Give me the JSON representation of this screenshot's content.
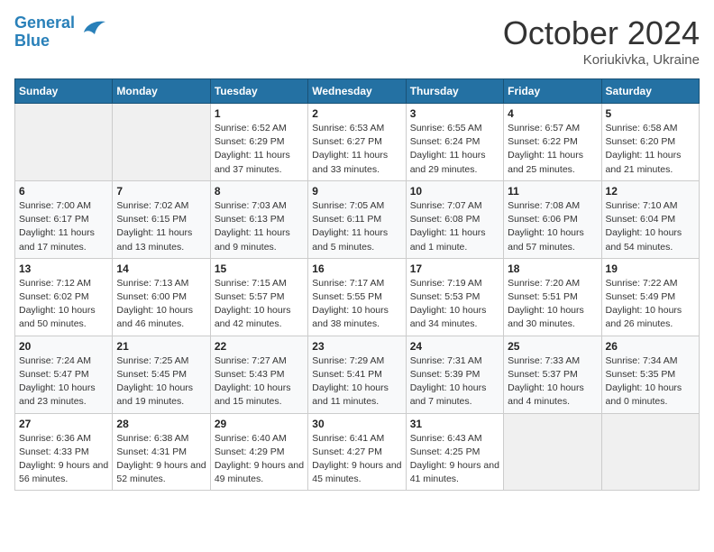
{
  "header": {
    "logo_line1": "General",
    "logo_line2": "Blue",
    "month": "October 2024",
    "location": "Koriukivka, Ukraine"
  },
  "days_of_week": [
    "Sunday",
    "Monday",
    "Tuesday",
    "Wednesday",
    "Thursday",
    "Friday",
    "Saturday"
  ],
  "weeks": [
    [
      {
        "day": "",
        "info": ""
      },
      {
        "day": "",
        "info": ""
      },
      {
        "day": "1",
        "info": "Sunrise: 6:52 AM\nSunset: 6:29 PM\nDaylight: 11 hours and 37 minutes."
      },
      {
        "day": "2",
        "info": "Sunrise: 6:53 AM\nSunset: 6:27 PM\nDaylight: 11 hours and 33 minutes."
      },
      {
        "day": "3",
        "info": "Sunrise: 6:55 AM\nSunset: 6:24 PM\nDaylight: 11 hours and 29 minutes."
      },
      {
        "day": "4",
        "info": "Sunrise: 6:57 AM\nSunset: 6:22 PM\nDaylight: 11 hours and 25 minutes."
      },
      {
        "day": "5",
        "info": "Sunrise: 6:58 AM\nSunset: 6:20 PM\nDaylight: 11 hours and 21 minutes."
      }
    ],
    [
      {
        "day": "6",
        "info": "Sunrise: 7:00 AM\nSunset: 6:17 PM\nDaylight: 11 hours and 17 minutes."
      },
      {
        "day": "7",
        "info": "Sunrise: 7:02 AM\nSunset: 6:15 PM\nDaylight: 11 hours and 13 minutes."
      },
      {
        "day": "8",
        "info": "Sunrise: 7:03 AM\nSunset: 6:13 PM\nDaylight: 11 hours and 9 minutes."
      },
      {
        "day": "9",
        "info": "Sunrise: 7:05 AM\nSunset: 6:11 PM\nDaylight: 11 hours and 5 minutes."
      },
      {
        "day": "10",
        "info": "Sunrise: 7:07 AM\nSunset: 6:08 PM\nDaylight: 11 hours and 1 minute."
      },
      {
        "day": "11",
        "info": "Sunrise: 7:08 AM\nSunset: 6:06 PM\nDaylight: 10 hours and 57 minutes."
      },
      {
        "day": "12",
        "info": "Sunrise: 7:10 AM\nSunset: 6:04 PM\nDaylight: 10 hours and 54 minutes."
      }
    ],
    [
      {
        "day": "13",
        "info": "Sunrise: 7:12 AM\nSunset: 6:02 PM\nDaylight: 10 hours and 50 minutes."
      },
      {
        "day": "14",
        "info": "Sunrise: 7:13 AM\nSunset: 6:00 PM\nDaylight: 10 hours and 46 minutes."
      },
      {
        "day": "15",
        "info": "Sunrise: 7:15 AM\nSunset: 5:57 PM\nDaylight: 10 hours and 42 minutes."
      },
      {
        "day": "16",
        "info": "Sunrise: 7:17 AM\nSunset: 5:55 PM\nDaylight: 10 hours and 38 minutes."
      },
      {
        "day": "17",
        "info": "Sunrise: 7:19 AM\nSunset: 5:53 PM\nDaylight: 10 hours and 34 minutes."
      },
      {
        "day": "18",
        "info": "Sunrise: 7:20 AM\nSunset: 5:51 PM\nDaylight: 10 hours and 30 minutes."
      },
      {
        "day": "19",
        "info": "Sunrise: 7:22 AM\nSunset: 5:49 PM\nDaylight: 10 hours and 26 minutes."
      }
    ],
    [
      {
        "day": "20",
        "info": "Sunrise: 7:24 AM\nSunset: 5:47 PM\nDaylight: 10 hours and 23 minutes."
      },
      {
        "day": "21",
        "info": "Sunrise: 7:25 AM\nSunset: 5:45 PM\nDaylight: 10 hours and 19 minutes."
      },
      {
        "day": "22",
        "info": "Sunrise: 7:27 AM\nSunset: 5:43 PM\nDaylight: 10 hours and 15 minutes."
      },
      {
        "day": "23",
        "info": "Sunrise: 7:29 AM\nSunset: 5:41 PM\nDaylight: 10 hours and 11 minutes."
      },
      {
        "day": "24",
        "info": "Sunrise: 7:31 AM\nSunset: 5:39 PM\nDaylight: 10 hours and 7 minutes."
      },
      {
        "day": "25",
        "info": "Sunrise: 7:33 AM\nSunset: 5:37 PM\nDaylight: 10 hours and 4 minutes."
      },
      {
        "day": "26",
        "info": "Sunrise: 7:34 AM\nSunset: 5:35 PM\nDaylight: 10 hours and 0 minutes."
      }
    ],
    [
      {
        "day": "27",
        "info": "Sunrise: 6:36 AM\nSunset: 4:33 PM\nDaylight: 9 hours and 56 minutes."
      },
      {
        "day": "28",
        "info": "Sunrise: 6:38 AM\nSunset: 4:31 PM\nDaylight: 9 hours and 52 minutes."
      },
      {
        "day": "29",
        "info": "Sunrise: 6:40 AM\nSunset: 4:29 PM\nDaylight: 9 hours and 49 minutes."
      },
      {
        "day": "30",
        "info": "Sunrise: 6:41 AM\nSunset: 4:27 PM\nDaylight: 9 hours and 45 minutes."
      },
      {
        "day": "31",
        "info": "Sunrise: 6:43 AM\nSunset: 4:25 PM\nDaylight: 9 hours and 41 minutes."
      },
      {
        "day": "",
        "info": ""
      },
      {
        "day": "",
        "info": ""
      }
    ]
  ]
}
